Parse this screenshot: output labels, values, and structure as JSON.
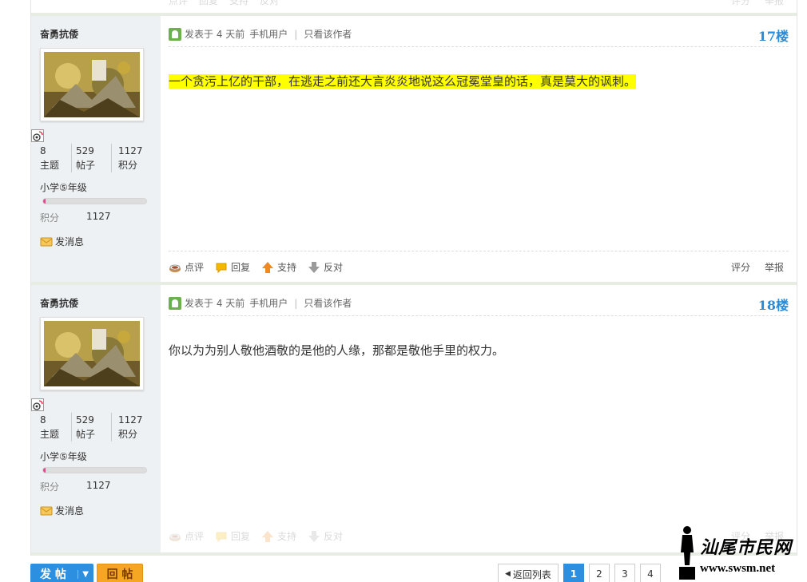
{
  "top_actions": {
    "comment": "点评",
    "reply": "回复",
    "support": "支持",
    "oppose": "反对",
    "rate": "评分",
    "report": "举报"
  },
  "posts": [
    {
      "author": "奋勇抗倭",
      "stats": [
        {
          "value": "8",
          "label": "主题"
        },
        {
          "value": "529",
          "label": "帖子"
        },
        {
          "value": "1127",
          "label": "积分"
        }
      ],
      "level": "小学⑤年级",
      "level_progress": 0.02,
      "credit_label": "积分",
      "credit_value": "1127",
      "send_msg": "发消息",
      "meta_posted": "发表于 4 天前",
      "meta_device": "手机用户",
      "meta_only_author": "只看该作者",
      "floor": "17楼",
      "text": "一个贪污上亿的干部，在逃走之前还大言炎炎地说这么冠冕堂皇的话，真是莫大的讽刺。",
      "highlighted": true,
      "actions": {
        "comment": "点评",
        "reply": "回复",
        "support": "支持",
        "oppose": "反对",
        "rate": "评分",
        "report": "举报"
      }
    },
    {
      "author": "奋勇抗倭",
      "stats": [
        {
          "value": "8",
          "label": "主题"
        },
        {
          "value": "529",
          "label": "帖子"
        },
        {
          "value": "1127",
          "label": "积分"
        }
      ],
      "level": "小学⑤年级",
      "level_progress": 0.02,
      "credit_label": "积分",
      "credit_value": "1127",
      "send_msg": "发消息",
      "meta_posted": "发表于 4 天前",
      "meta_device": "手机用户",
      "meta_only_author": "只看该作者",
      "floor": "18楼",
      "text": "你以为为别人敬他酒敬的是他的人缘，那都是敬他手里的权力。",
      "highlighted": false,
      "actions": {
        "comment": "点评",
        "reply": "回复",
        "support": "支持",
        "oppose": "反对",
        "rate": "评分",
        "report": "举报"
      }
    }
  ],
  "footer": {
    "post_button": "发 帖",
    "reply_button": "回 帖",
    "back_to_list": "返回列表",
    "pages": [
      "1",
      "2",
      "3",
      "4"
    ],
    "current_page": "1"
  },
  "watermark": {
    "text": "汕尾市民网",
    "url": "www.swsm.net"
  },
  "colors": {
    "accent": "#2d8fe0",
    "highlight": "#ffff00",
    "floor": "#2a8bd8",
    "reply_button": "#f5a623"
  }
}
